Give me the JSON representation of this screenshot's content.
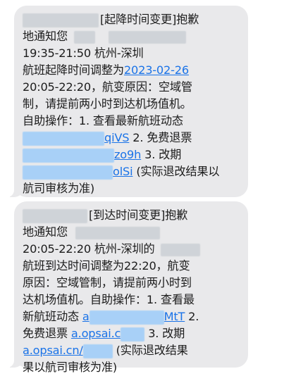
{
  "messages": [
    {
      "header": "[起降时间变更]抱歉",
      "lines": [
        "地通知您",
        "19:35-21:50 杭州-深圳",
        "航班起降时间调整为",
        "2023-02-26",
        "20:05-22:20，航变原因：空域管",
        "制，请提前两小时到达机场值机。",
        "自助操作：1. 查看最新航班动态"
      ],
      "link1_tail": "qiVS",
      "step2": " 2. 免费退票",
      "link2_tail": "zo9h",
      "step3": " 3. 改期",
      "link3_tail": "olSi",
      "note1": " (实际退改结果以",
      "note2": "航司审核为准)"
    },
    {
      "header": "[到达时间变更]抱歉",
      "lines": [
        "地通知您",
        "20:05-22:20 杭州-深圳的",
        "航班到达时间调整为22:20，航变",
        "原因：空域管制，请提前两小时到",
        "达机场值机。自助操作：1. 查看最",
        "新航班动态"
      ],
      "link1_head": "a",
      "link1_tail": "MtT",
      "step2": " 2.",
      "refund": "免费退票",
      "link2": "a.opsai.c",
      "step3": " 3. 改期",
      "link3": "a.opsai.cn/",
      "note1": " (实际退改结果",
      "note2": "果以航司审核为准)"
    }
  ],
  "colors": {
    "bubble": "#e9e9eb",
    "link": "#1a73e8",
    "redact": "#cfd3d8",
    "redact_link": "#a8d0f7"
  }
}
